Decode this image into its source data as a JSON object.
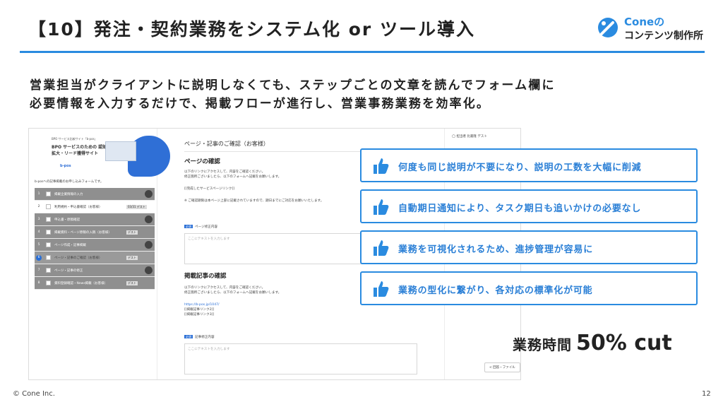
{
  "slide": {
    "title": "【10】発注・契約業務をシステム化 or ツール導入",
    "lead_line1": "営業担当がクライアントに説明しなくても、ステップごとの文章を読んでフォーム欄に",
    "lead_line2": "必要情報を入力するだけで、掲載フローが進行し、営業事務業務を効率化。",
    "result_label": "業務時間",
    "result_value": "50% cut",
    "footer_copyright": "© Cone Inc.",
    "page_number": "12"
  },
  "logo": {
    "brand": "Coneの",
    "subtitle": "コンテンツ制作所",
    "accent": "#2a8be0",
    "icon": "cone-logo-icon"
  },
  "screenshot": {
    "hero_small": "BPO サービス比較サイト「b-pos」",
    "hero_title": "BPO サービスのための 認知拡大・リード獲得サイト",
    "hero_brand": "b-pos",
    "side_lead": "b-posへの記事掲載のお申し込みフォームです。",
    "steps": [
      {
        "num": "1",
        "label": "掲載企業情報の入力",
        "tag": "",
        "state": "done"
      },
      {
        "num": "2",
        "label": "利用規約・申込書確認（お客様）",
        "tag": "03/31 デスト",
        "state": "normal"
      },
      {
        "num": "3",
        "label": "申込書・原稿確認",
        "tag": "",
        "state": "done"
      },
      {
        "num": "4",
        "label": "掲載資料・ページ原稿の入稿（お客様）",
        "tag": "デスト",
        "state": "done"
      },
      {
        "num": "5",
        "label": "ページ作成・記事掲載",
        "tag": "",
        "state": "done"
      },
      {
        "num": "6",
        "label": "ページ・記事のご確認（お客様）",
        "tag": "デスト",
        "state": "active"
      },
      {
        "num": "7",
        "label": "ページ・記事の修正",
        "tag": "",
        "state": "done"
      },
      {
        "num": "8",
        "label": "資料登録確認・News掲載（お客様）",
        "tag": "デスト",
        "state": "done"
      }
    ],
    "content_title": "ページ・記事のご確認（お客様）",
    "section1_heading": "ページの確認",
    "section1_text1": "以下のリンクにアクセスして、内容をご確認ください。",
    "section1_text2": "修正箇所ございましたら、以下のフォームへ記載をお願いします。",
    "section1_link": "[[完成したサービスページリンク]]",
    "section1_note": "※ ご確認期限は本ページ上部に記載されていますので、期日までにご対応をお願いいたします。",
    "form1_required": "必須",
    "form1_label": "ページ修正内容",
    "form1_placeholder": "ここにテキストを入力します",
    "section2_heading": "掲載記事の確認",
    "section2_text1": "以下のリンクにアクセスして、内容をご確認ください。",
    "section2_text2": "修正箇所ございましたら、以下のフォームへ記載をお願いします。",
    "section2_url": "https://b-pos.jp/1047/",
    "section2_link2": "[[掲載記事リンク2]]",
    "section2_link3": "[[掲載記事リンク3]]",
    "form2_required": "必須",
    "form2_label": "記事修正内容",
    "form2_placeholder": "ここにテキストを入力します",
    "right_assignee_label": "担当者",
    "right_assignee_name": "比嘉隆",
    "right_assignee_tag": "デスト",
    "right_button": "< 回答・ファイル"
  },
  "callouts": [
    {
      "text": "何度も同じ説明が不要になり、説明の工数を大幅に削減"
    },
    {
      "text": "自動期日通知により、タスク期日も追いかけの必要なし"
    },
    {
      "text": "業務を可視化されるため、進捗管理が容易に"
    },
    {
      "text": "業務の型化に繋がり、各対応の標準化が可能"
    }
  ]
}
